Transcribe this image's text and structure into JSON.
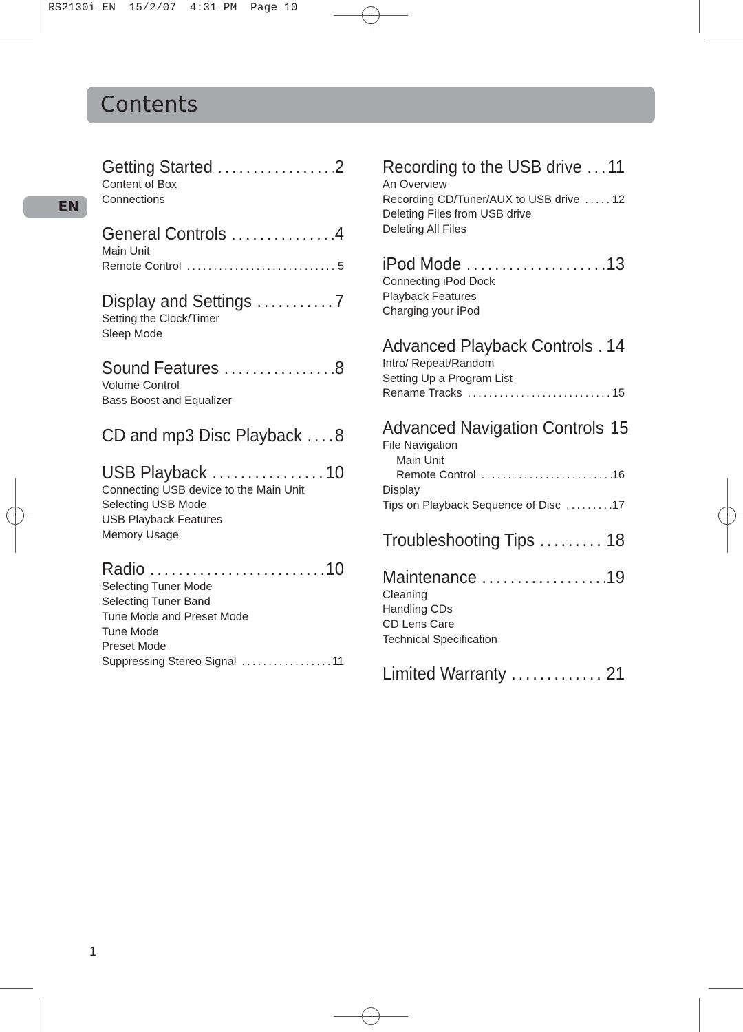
{
  "print_slug": "RS2130i EN  15/2/07  4:31 PM  Page 10",
  "header": {
    "title": "Contents"
  },
  "language_tab": "EN",
  "footer": {
    "page_number": "1"
  },
  "toc": {
    "left": [
      {
        "title": "Getting Started",
        "page": "2",
        "items": [
          {
            "label": "Content of Box"
          },
          {
            "label": "Connections"
          }
        ]
      },
      {
        "title": "General Controls",
        "page": "4",
        "items": [
          {
            "label": "Main Unit"
          },
          {
            "label": "Remote Control",
            "page": "5"
          }
        ]
      },
      {
        "title": "Display and Settings",
        "page": "7",
        "items": [
          {
            "label": "Setting the Clock/Timer"
          },
          {
            "label": "Sleep Mode"
          }
        ]
      },
      {
        "title": "Sound Features",
        "page": "8",
        "items": [
          {
            "label": "Volume Control"
          },
          {
            "label": "Bass Boost and Equalizer"
          }
        ]
      },
      {
        "title": "CD and mp3 Disc Playback",
        "page": "8",
        "items": []
      },
      {
        "title": "USB Playback",
        "page": "10",
        "items": [
          {
            "label": "Connecting USB device to the Main Unit"
          },
          {
            "label": "Selecting USB Mode"
          },
          {
            "label": "USB Playback Features"
          },
          {
            "label": "Memory Usage"
          }
        ]
      },
      {
        "title": "Radio",
        "page": "10",
        "items": [
          {
            "label": "Selecting Tuner Mode"
          },
          {
            "label": "Selecting Tuner Band"
          },
          {
            "label": "Tune Mode and Preset Mode"
          },
          {
            "label": "Tune Mode"
          },
          {
            "label": "Preset Mode"
          },
          {
            "label": "Suppressing Stereo Signal",
            "page": "11"
          }
        ]
      }
    ],
    "right": [
      {
        "title": "Recording to the USB drive",
        "page": "11",
        "items": [
          {
            "label": "An Overview"
          },
          {
            "label": "Recording CD/Tuner/AUX to USB drive",
            "page": "12"
          },
          {
            "label": "Deleting Files from USB drive"
          },
          {
            "label": "Deleting All Files"
          }
        ]
      },
      {
        "title": "iPod Mode",
        "page": "13",
        "items": [
          {
            "label": "Connecting iPod Dock"
          },
          {
            "label": "Playback Features"
          },
          {
            "label": "Charging your iPod"
          }
        ]
      },
      {
        "title": "Advanced Playback Controls",
        "page": "14",
        "items": [
          {
            "label": "Intro/ Repeat/Random"
          },
          {
            "label": "Setting Up a Program List"
          },
          {
            "label": "Rename Tracks",
            "page": "15"
          }
        ]
      },
      {
        "title": "Advanced Navigation Controls",
        "page": "15",
        "items": [
          {
            "label": "File Navigation"
          },
          {
            "label": "Main Unit",
            "indent": true
          },
          {
            "label": "Remote Control",
            "page": "16",
            "indent": true
          },
          {
            "label": "Display"
          },
          {
            "label": "Tips on Playback Sequence of Disc",
            "page": "17"
          }
        ]
      },
      {
        "title": "Troubleshooting Tips",
        "page": "18",
        "items": []
      },
      {
        "title": "Maintenance",
        "page": "19",
        "items": [
          {
            "label": "Cleaning"
          },
          {
            "label": "Handling CDs"
          },
          {
            "label": "CD Lens Care"
          },
          {
            "label": "Technical Specification"
          }
        ]
      },
      {
        "title": "Limited Warranty",
        "page": "21",
        "items": []
      }
    ]
  }
}
